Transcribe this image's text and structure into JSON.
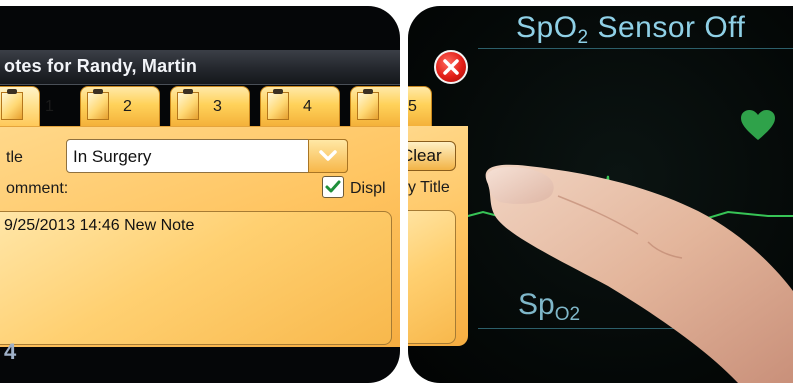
{
  "dialog": {
    "title": "otes for Randy, Martin",
    "tabs": [
      {
        "label": "1"
      },
      {
        "label": "2"
      },
      {
        "label": "3"
      },
      {
        "label": "4"
      },
      {
        "label": "5"
      }
    ],
    "title_label": "tle",
    "title_value": "In Surgery",
    "comment_label": "omment:",
    "display_title_label": "Displ",
    "display_title_suffix": "y Title",
    "display_title_checked": true,
    "comment_text": "9/25/2013 14:46 New Note",
    "clear_label": "Clear",
    "bottom_mark": "4"
  },
  "monitor": {
    "banner_prefix": "SpO",
    "banner_sub": "2",
    "banner_suffix": " Sensor Off",
    "bottom_prefix": "Sp",
    "bottom_sub": "O2"
  },
  "colors": {
    "tab_gold": "#ffd25a",
    "close_red": "#e21e17",
    "banner_cyan": "#8fd0e6",
    "ecg_green": "#37c456",
    "heart_green": "#2fa24a"
  },
  "icons": {
    "close": "close-icon",
    "tab": "note-icon",
    "dropdown": "chevron-down-icon",
    "check": "check-icon",
    "heart": "heart-icon"
  }
}
